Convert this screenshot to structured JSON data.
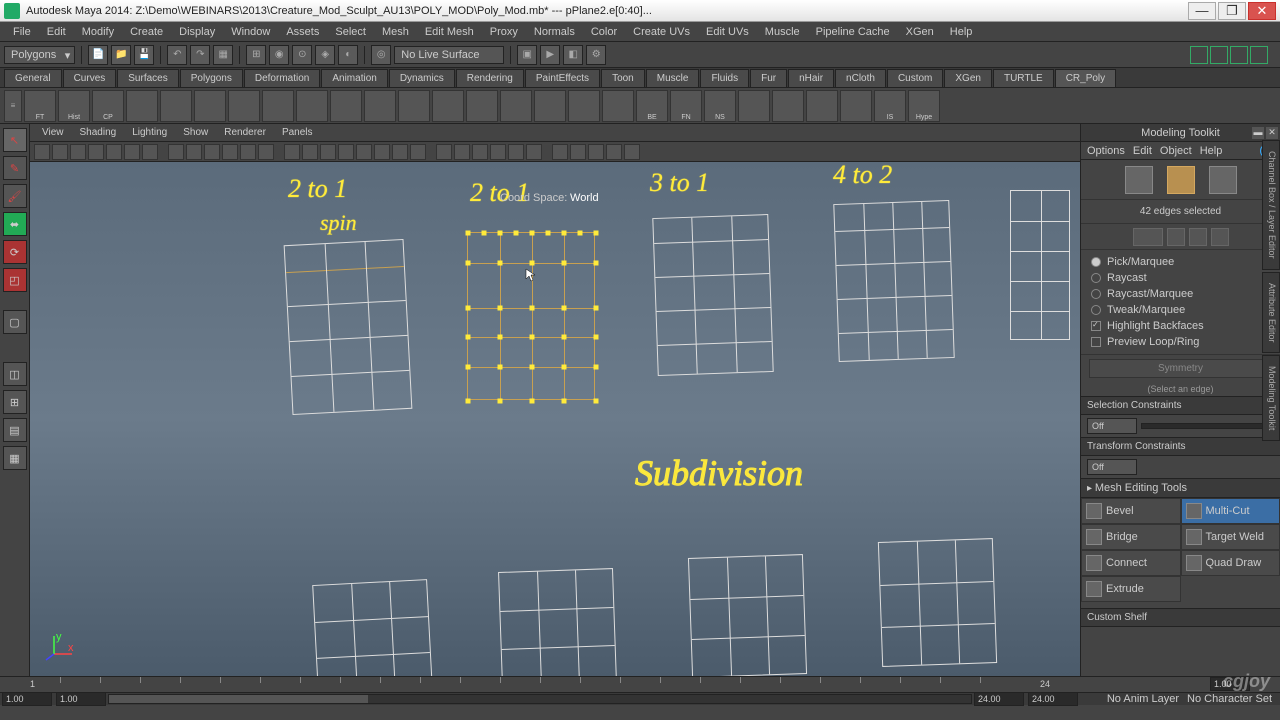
{
  "title": "Autodesk Maya 2014: Z:\\Demo\\WEBINARS\\2013\\Creature_Mod_Sculpt_AU13\\POLY_MOD\\Poly_Mod.mb*  ---  pPlane2.e[0:40]...",
  "menus": [
    "File",
    "Edit",
    "Modify",
    "Create",
    "Display",
    "Window",
    "Assets",
    "Select",
    "Mesh",
    "Edit Mesh",
    "Proxy",
    "Normals",
    "Color",
    "Create UVs",
    "Edit UVs",
    "Muscle",
    "Pipeline Cache",
    "XGen",
    "Help"
  ],
  "mode_dropdown": "Polygons",
  "live_surface": "No Live Surface",
  "tabs": [
    "General",
    "Curves",
    "Surfaces",
    "Polygons",
    "Deformation",
    "Animation",
    "Dynamics",
    "Rendering",
    "PaintEffects",
    "Toon",
    "Muscle",
    "Fluids",
    "Fur",
    "nHair",
    "nCloth",
    "Custom",
    "XGen",
    "TURTLE",
    "CR_Poly"
  ],
  "active_tab": "CR_Poly",
  "shelf_labels": [
    "FT",
    "Hist",
    "CP",
    "",
    "",
    "",
    "",
    "",
    "",
    "",
    "",
    "",
    "",
    "",
    "",
    "",
    "",
    "",
    "BE",
    "FN",
    "NS",
    "",
    "",
    "",
    "",
    "IS",
    "Hype"
  ],
  "view_menus": [
    "View",
    "Shading",
    "Lighting",
    "Show",
    "Renderer",
    "Panels"
  ],
  "viewport": {
    "annot1": "2 to 1",
    "annot1b": "spin",
    "annot2": "2 to 1",
    "annot3": "3 to 1",
    "annot4": "4 to 2",
    "annot5": "Subdivision",
    "coord_label": "Coord Space:",
    "coord_value": "World"
  },
  "toolkit": {
    "title": "Modeling Toolkit",
    "menus": [
      "Options",
      "Edit",
      "Object",
      "Help"
    ],
    "status": "42 edges selected",
    "sel_modes": [
      {
        "label": "Pick/Marquee",
        "type": "radio",
        "on": true
      },
      {
        "label": "Raycast",
        "type": "radio",
        "on": false
      },
      {
        "label": "Raycast/Marquee",
        "type": "radio",
        "on": false
      },
      {
        "label": "Tweak/Marquee",
        "type": "radio",
        "on": false,
        "dim": true
      },
      {
        "label": "Highlight Backfaces",
        "type": "check",
        "on": true
      },
      {
        "label": "Preview Loop/Ring",
        "type": "check",
        "on": false
      }
    ],
    "symmetry_btn": "Symmetry",
    "symmetry_hint": "(Select an edge)",
    "sec_sel": "Selection Constraints",
    "sec_trans": "Transform Constraints",
    "off": "Off",
    "sec_mesh": "Mesh Editing Tools",
    "tools": [
      {
        "label": "Bevel",
        "active": false
      },
      {
        "label": "Multi-Cut",
        "active": true
      },
      {
        "label": "Bridge",
        "active": false
      },
      {
        "label": "Target Weld",
        "active": false
      },
      {
        "label": "Connect",
        "active": false
      },
      {
        "label": "Quad Draw",
        "active": false
      },
      {
        "label": "Extrude",
        "active": false
      }
    ],
    "sec_shelf": "Custom Shelf"
  },
  "side_tabs": [
    "Channel Box / Layer Editor",
    "Attribute Editor",
    "Modeling Toolkit"
  ],
  "timeline": {
    "start": "1.00",
    "range_start": "1.00",
    "range_end": "24.00",
    "end": "24.00",
    "current": "1",
    "mid": "24",
    "cur2": "1.00"
  },
  "status": {
    "anim": "No Anim Layer",
    "char": "No Character Set"
  },
  "watermark": "cgjoy"
}
